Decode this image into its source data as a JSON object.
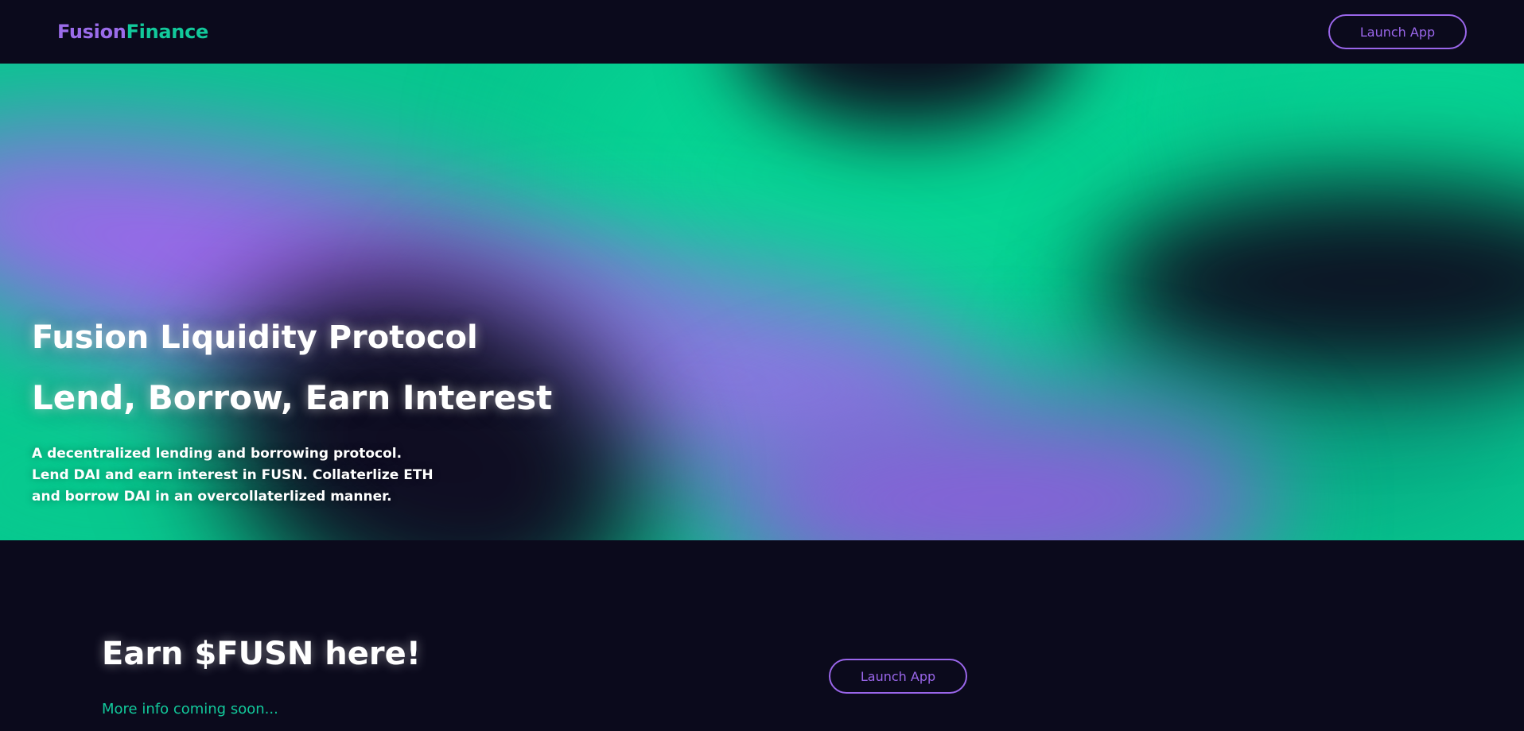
{
  "brand": {
    "part1": "Fusion",
    "part2": "Finance",
    "part1_color": "#9b6cea",
    "part2_color": "#12c99b"
  },
  "nav": {
    "launch_label": "Launch App"
  },
  "hero": {
    "title": "Fusion Liquidity Protocol",
    "subtitle": "Lend, Borrow, Earn Interest",
    "description_lines": [
      "A decentralized lending and borrowing protocol.",
      "Lend DAI and earn interest in FUSN. Collaterlize ETH",
      "and borrow DAI in an overcollaterlized manner."
    ]
  },
  "cta": {
    "title": "Earn $FUSN here!",
    "note": "More info coming soon...",
    "launch_label": "Launch App"
  },
  "colors": {
    "background": "#0b0a1c",
    "accent_purple": "#9a66ea",
    "accent_green": "#12c99b"
  }
}
